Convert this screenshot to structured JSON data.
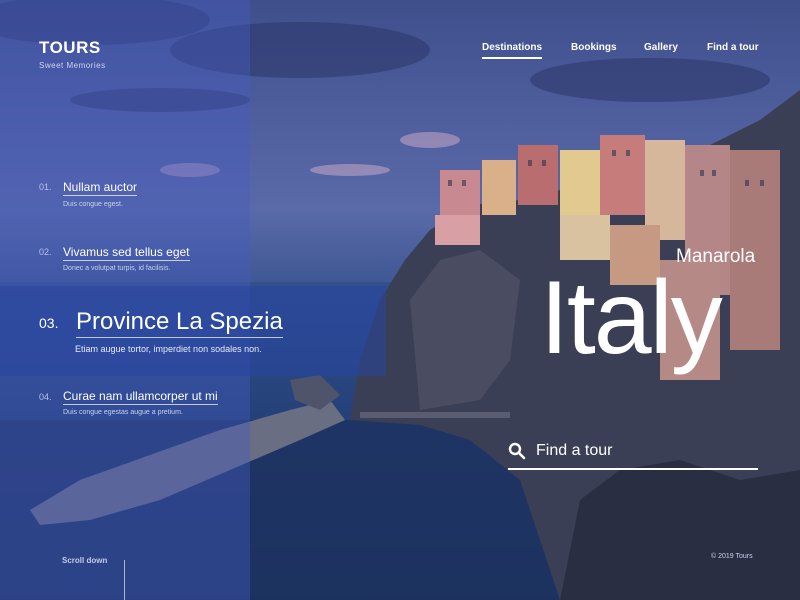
{
  "brand": {
    "logo": "TOURS",
    "tagline": "Sweet  Memories"
  },
  "nav": [
    {
      "label": "Destinations",
      "active": true
    },
    {
      "label": "Bookings",
      "active": false
    },
    {
      "label": "Gallery",
      "active": false
    },
    {
      "label": "Find a tour",
      "active": false
    }
  ],
  "slides": [
    {
      "num": "01.",
      "title": "Nullam auctor",
      "desc": "Duis congue egest."
    },
    {
      "num": "02.",
      "title": "Vivamus sed tellus eget",
      "desc": "Donec a volutpat turpis, id facilisis."
    },
    {
      "num": "03.",
      "title": "Province La Spezia",
      "desc": "Etiam augue tortor, imperdiet non sodales non."
    },
    {
      "num": "04.",
      "title": "Curae nam ullamcorper ut mi",
      "desc": "Duis congue egestas augue a pretium."
    }
  ],
  "hero": {
    "place": "Manarola",
    "country": "Italy"
  },
  "search": {
    "placeholder": "Find a tour",
    "icon": "search-icon"
  },
  "footer": {
    "scroll": "Scroll down",
    "copyright": "© 2019 Tours"
  }
}
